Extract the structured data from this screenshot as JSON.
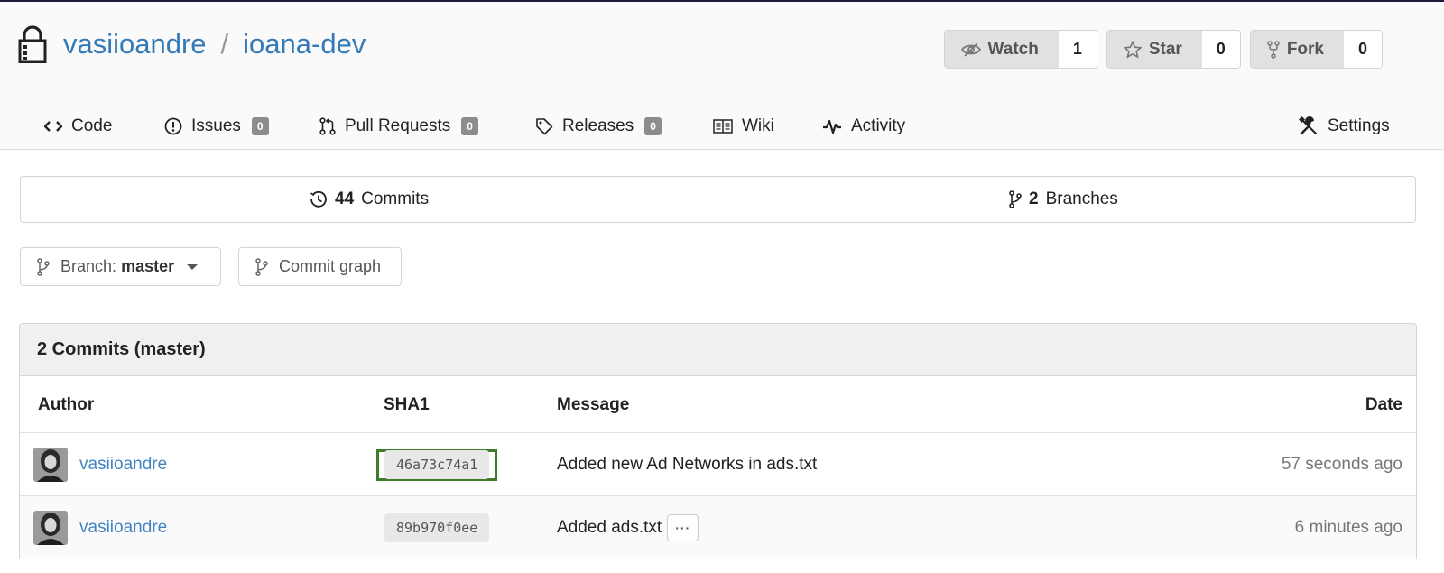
{
  "repo": {
    "owner": "vasiioandre",
    "separator": "/",
    "name": "ioana-dev"
  },
  "actions": [
    {
      "label": "Watch",
      "count": "1",
      "icon": "eye-slash-icon"
    },
    {
      "label": "Star",
      "count": "0",
      "icon": "star-icon"
    },
    {
      "label": "Fork",
      "count": "0",
      "icon": "fork-icon"
    }
  ],
  "tabs": {
    "code": {
      "label": "Code",
      "icon": "code-icon"
    },
    "issues": {
      "label": "Issues",
      "count": "0",
      "icon": "issue-icon"
    },
    "pulls": {
      "label": "Pull Requests",
      "count": "0",
      "icon": "pull-request-icon"
    },
    "releases": {
      "label": "Releases",
      "count": "0",
      "icon": "tag-icon"
    },
    "wiki": {
      "label": "Wiki",
      "icon": "book-icon"
    },
    "activity": {
      "label": "Activity",
      "icon": "pulse-icon"
    },
    "settings": {
      "label": "Settings",
      "icon": "tools-icon"
    }
  },
  "stats": {
    "commits": {
      "count": "44",
      "label": "Commits"
    },
    "branches": {
      "count": "2",
      "label": "Branches"
    }
  },
  "branch_selector": {
    "prefix": "Branch:",
    "value": "master"
  },
  "commit_graph_label": "Commit graph",
  "commits_table": {
    "title": "2 Commits (master)",
    "columns": {
      "author": "Author",
      "sha": "SHA1",
      "message": "Message",
      "date": "Date"
    },
    "rows": [
      {
        "author": "vasiioandre",
        "sha": "46a73c74a1",
        "message": "Added new Ad Networks in ads.txt",
        "date": "57 seconds ago",
        "focused": true
      },
      {
        "author": "vasiioandre",
        "sha": "89b970f0ee",
        "message": "Added ads.txt",
        "date": "6 minutes ago",
        "has_more": true,
        "more_label": "···"
      }
    ]
  },
  "colors": {
    "link": "#337ab7",
    "author_link": "#4183c4",
    "focus_outline": "#3f7b2a",
    "badge": "#8c8c8c"
  }
}
